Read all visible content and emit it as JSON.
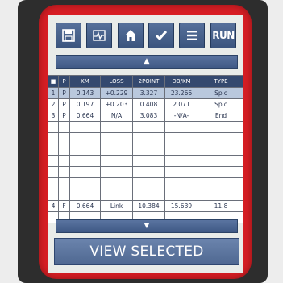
{
  "toolbar": {
    "buttons": [
      {
        "icon": "save-icon"
      },
      {
        "icon": "trace-icon"
      },
      {
        "icon": "home-icon"
      },
      {
        "icon": "check-icon"
      },
      {
        "icon": "menu-icon"
      },
      {
        "label": "RUN"
      }
    ]
  },
  "scroll": {
    "up_icon": "▲",
    "down_icon": "▼"
  },
  "table": {
    "headers": [
      "■",
      "P",
      "KM",
      "LOSS",
      "2POINT",
      "DB/KM",
      "TYPE"
    ],
    "rows": [
      [
        "1",
        "P",
        "0.143",
        "+0.229",
        "3.327",
        "23.266",
        "Splc"
      ],
      [
        "2",
        "P",
        "0.197",
        "+0.203",
        "0.408",
        "2.071",
        "Splc"
      ],
      [
        "3",
        "P",
        "0.664",
        "N/A",
        "3.083",
        "-N/A-",
        "End"
      ],
      [
        "",
        "",
        "",
        "",
        "",
        "",
        ""
      ],
      [
        "",
        "",
        "",
        "",
        "",
        "",
        ""
      ],
      [
        "",
        "",
        "",
        "",
        "",
        "",
        ""
      ],
      [
        "",
        "",
        "",
        "",
        "",
        "",
        ""
      ],
      [
        "",
        "",
        "",
        "",
        "",
        "",
        ""
      ],
      [
        "",
        "",
        "",
        "",
        "",
        "",
        ""
      ],
      [
        "",
        "",
        "",
        "",
        "",
        "",
        ""
      ],
      [
        "4",
        "F",
        "0.664",
        "Link",
        "10.384",
        "15.639",
        "11.8"
      ],
      [
        "",
        "",
        "",
        "",
        "",
        "",
        ""
      ]
    ]
  },
  "view_selected_label": "VIEW SELECTED",
  "colors": {
    "casing": "#d81e24",
    "accent": "#3f5985",
    "header": "#34496f",
    "selected_row": "#b9c8dd"
  }
}
